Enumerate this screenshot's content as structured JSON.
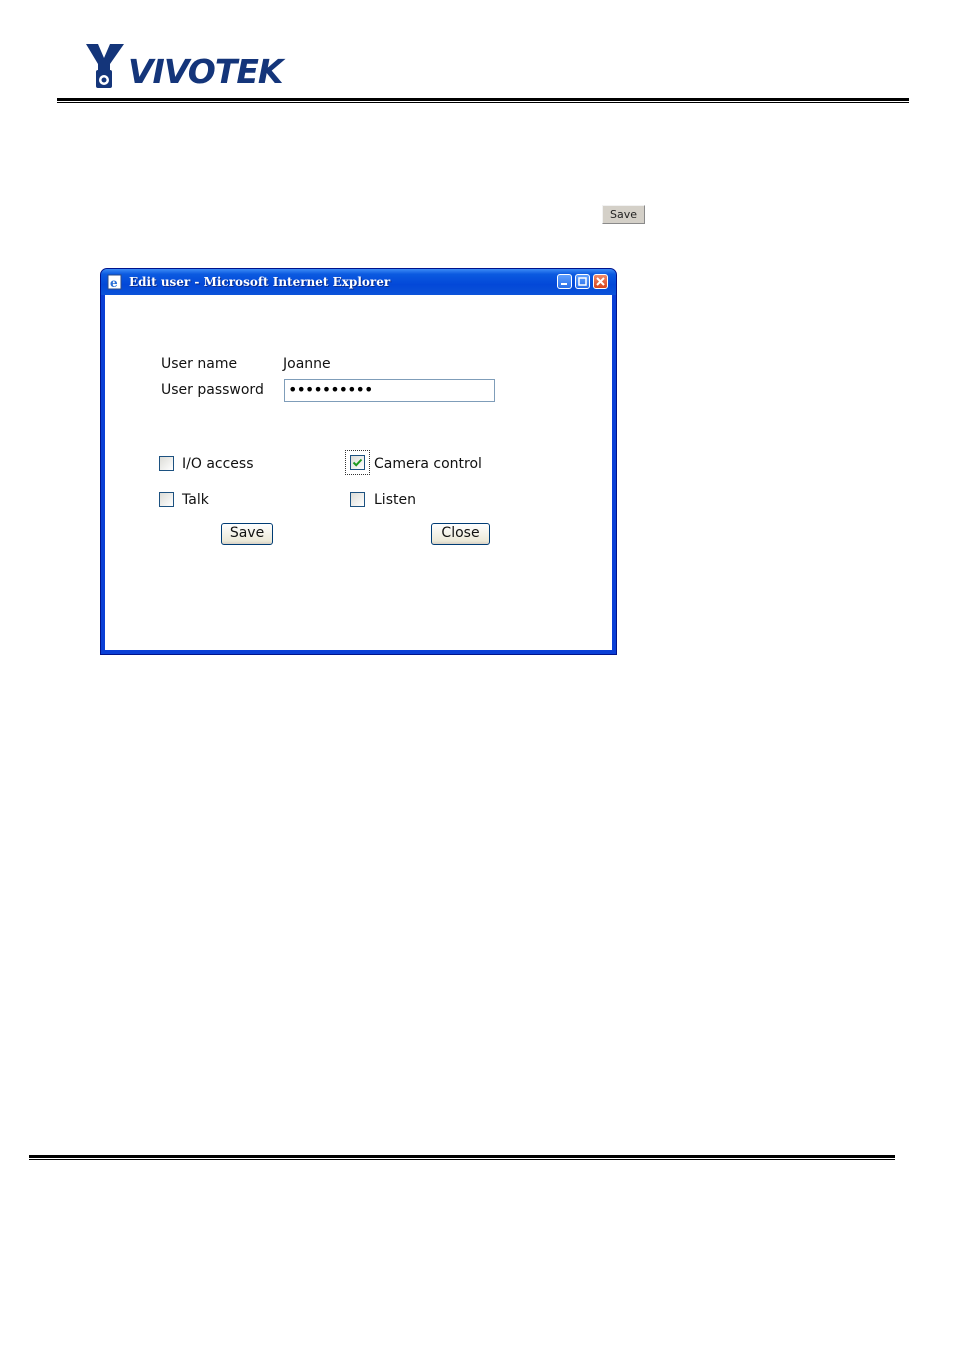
{
  "brand": {
    "logo_text": "VIVOTEK"
  },
  "toolbar": {
    "inline_save_label": "Save"
  },
  "window": {
    "title": "Edit user - Microsoft Internet Explorer",
    "form": {
      "username_label": "User name",
      "username_value": "Joanne",
      "password_label": "User password",
      "password_value": "••••••••••",
      "permissions": [
        {
          "label": "I/O access",
          "checked": false
        },
        {
          "label": "Camera control",
          "checked": true
        },
        {
          "label": "Talk",
          "checked": false
        },
        {
          "label": "Listen",
          "checked": false
        }
      ],
      "save_label": "Save",
      "close_label": "Close"
    }
  },
  "colors": {
    "titlebar": "#0348d8",
    "window_border": "#0a3fd6",
    "logo": "#14357a",
    "check": "#1e9a1e"
  }
}
